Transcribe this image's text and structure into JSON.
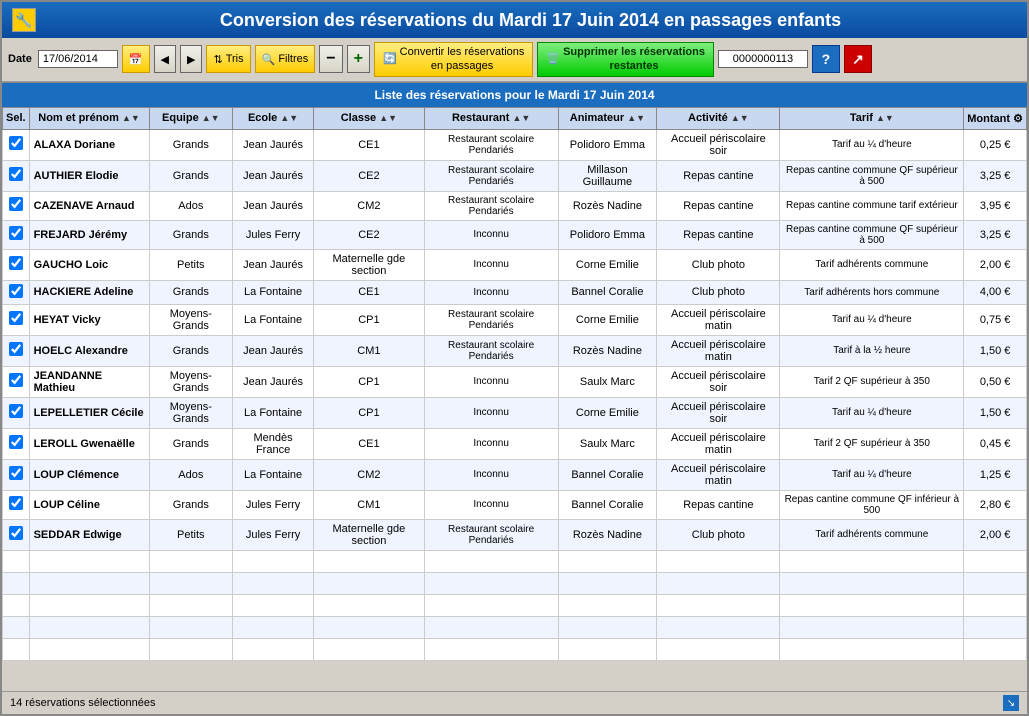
{
  "title": "Conversion des réservations du  Mardi 17 Juin 2014 en passages enfants",
  "toolbar": {
    "date_label": "Date",
    "date_value": "17/06/2014",
    "btn_calendar": "📅",
    "btn_prev": "◀",
    "btn_next": "▶",
    "btn_tris": "Tris",
    "btn_filtres": "Filtres",
    "btn_minus": "−",
    "btn_plus": "+",
    "btn_convert": "Convertir les réservations\nen passages",
    "btn_supprimer": "Supprimer les réservations\nrestantes",
    "num_value": "0000000113",
    "btn_help": "?",
    "btn_close": "🔴"
  },
  "section_header": "Liste des réservations pour le Mardi 17 Juin 2014",
  "columns": [
    "Sel.",
    "Nom et prénom",
    "Equipe",
    "Ecole",
    "Classe",
    "Restaurant",
    "Animateur",
    "Activité",
    "Tarif",
    "Montant"
  ],
  "rows": [
    {
      "checked": true,
      "nom": "ALAXA Doriane",
      "equipe": "Grands",
      "ecole": "Jean Jaurés",
      "classe": "CE1",
      "restaurant": "Restaurant scolaire Pendariés",
      "animateur": "Polidoro Emma",
      "activite": "Accueil périscolaire soir",
      "tarif": "Tarif au ¼ d'heure",
      "montant": "0,25 €"
    },
    {
      "checked": true,
      "nom": "AUTHIER Elodie",
      "equipe": "Grands",
      "ecole": "Jean Jaurés",
      "classe": "CE2",
      "restaurant": "Restaurant scolaire Pendariés",
      "animateur": "Millason Guillaume",
      "activite": "Repas cantine",
      "tarif": "Repas cantine commune QF supérieur à 500",
      "montant": "3,25 €"
    },
    {
      "checked": true,
      "nom": "CAZENAVE Arnaud",
      "equipe": "Ados",
      "ecole": "Jean Jaurés",
      "classe": "CM2",
      "restaurant": "Restaurant scolaire Pendariés",
      "animateur": "Rozès Nadine",
      "activite": "Repas cantine",
      "tarif": "Repas cantine commune tarif extérieur",
      "montant": "3,95 €"
    },
    {
      "checked": true,
      "nom": "FREJARD Jérémy",
      "equipe": "Grands",
      "ecole": "Jules Ferry",
      "classe": "CE2",
      "restaurant": "Inconnu",
      "animateur": "Polidoro Emma",
      "activite": "Repas cantine",
      "tarif": "Repas cantine commune QF supérieur à 500",
      "montant": "3,25 €"
    },
    {
      "checked": true,
      "nom": "GAUCHO Loic",
      "equipe": "Petits",
      "ecole": "Jean Jaurés",
      "classe": "Maternelle gde section",
      "restaurant": "Inconnu",
      "animateur": "Corne Emilie",
      "activite": "Club photo",
      "tarif": "Tarif adhérents commune",
      "montant": "2,00 €"
    },
    {
      "checked": true,
      "nom": "HACKIERE Adeline",
      "equipe": "Grands",
      "ecole": "La Fontaine",
      "classe": "CE1",
      "restaurant": "Inconnu",
      "animateur": "Bannel Coralie",
      "activite": "Club photo",
      "tarif": "Tarif adhérents hors commune",
      "montant": "4,00 €"
    },
    {
      "checked": true,
      "nom": "HEYAT Vicky",
      "equipe": "Moyens-Grands",
      "ecole": "La Fontaine",
      "classe": "CP1",
      "restaurant": "Restaurant scolaire Pendariés",
      "animateur": "Corne Emilie",
      "activite": "Accueil périscolaire matin",
      "tarif": "Tarif au ¼ d'heure",
      "montant": "0,75 €"
    },
    {
      "checked": true,
      "nom": "HOELC Alexandre",
      "equipe": "Grands",
      "ecole": "Jean Jaurés",
      "classe": "CM1",
      "restaurant": "Restaurant scolaire Pendariés",
      "animateur": "Rozès Nadine",
      "activite": "Accueil périscolaire matin",
      "tarif": "Tarif à la ½ heure",
      "montant": "1,50 €"
    },
    {
      "checked": true,
      "nom": "JEANDANNE Mathieu",
      "equipe": "Moyens-Grands",
      "ecole": "Jean Jaurés",
      "classe": "CP1",
      "restaurant": "Inconnu",
      "animateur": "Saulx Marc",
      "activite": "Accueil périscolaire soir",
      "tarif": "Tarif 2 QF supérieur à 350",
      "montant": "0,50 €"
    },
    {
      "checked": true,
      "nom": "LEPELLETIER Cécile",
      "equipe": "Moyens-Grands",
      "ecole": "La Fontaine",
      "classe": "CP1",
      "restaurant": "Inconnu",
      "animateur": "Corne Emilie",
      "activite": "Accueil périscolaire soir",
      "tarif": "Tarif au ¼ d'heure",
      "montant": "1,50 €"
    },
    {
      "checked": true,
      "nom": "LEROLL Gwenaëlle",
      "equipe": "Grands",
      "ecole": "Mendès France",
      "classe": "CE1",
      "restaurant": "Inconnu",
      "animateur": "Saulx Marc",
      "activite": "Accueil périscolaire matin",
      "tarif": "Tarif 2 QF supérieur à 350",
      "montant": "0,45 €"
    },
    {
      "checked": true,
      "nom": "LOUP Clémence",
      "equipe": "Ados",
      "ecole": "La Fontaine",
      "classe": "CM2",
      "restaurant": "Inconnu",
      "animateur": "Bannel Coralie",
      "activite": "Accueil périscolaire matin",
      "tarif": "Tarif au ¼ d'heure",
      "montant": "1,25 €"
    },
    {
      "checked": true,
      "nom": "LOUP Céline",
      "equipe": "Grands",
      "ecole": "Jules Ferry",
      "classe": "CM1",
      "restaurant": "Inconnu",
      "animateur": "Bannel Coralie",
      "activite": "Repas cantine",
      "tarif": "Repas cantine commune QF inférieur à 500",
      "montant": "2,80 €"
    },
    {
      "checked": true,
      "nom": "SEDDAR Edwige",
      "equipe": "Petits",
      "ecole": "Jules Ferry",
      "classe": "Maternelle gde section",
      "restaurant": "Restaurant scolaire Pendariés",
      "animateur": "Rozès Nadine",
      "activite": "Club photo",
      "tarif": "Tarif adhérents commune",
      "montant": "2,00 €"
    }
  ],
  "status": "14 réservations sélectionnées"
}
